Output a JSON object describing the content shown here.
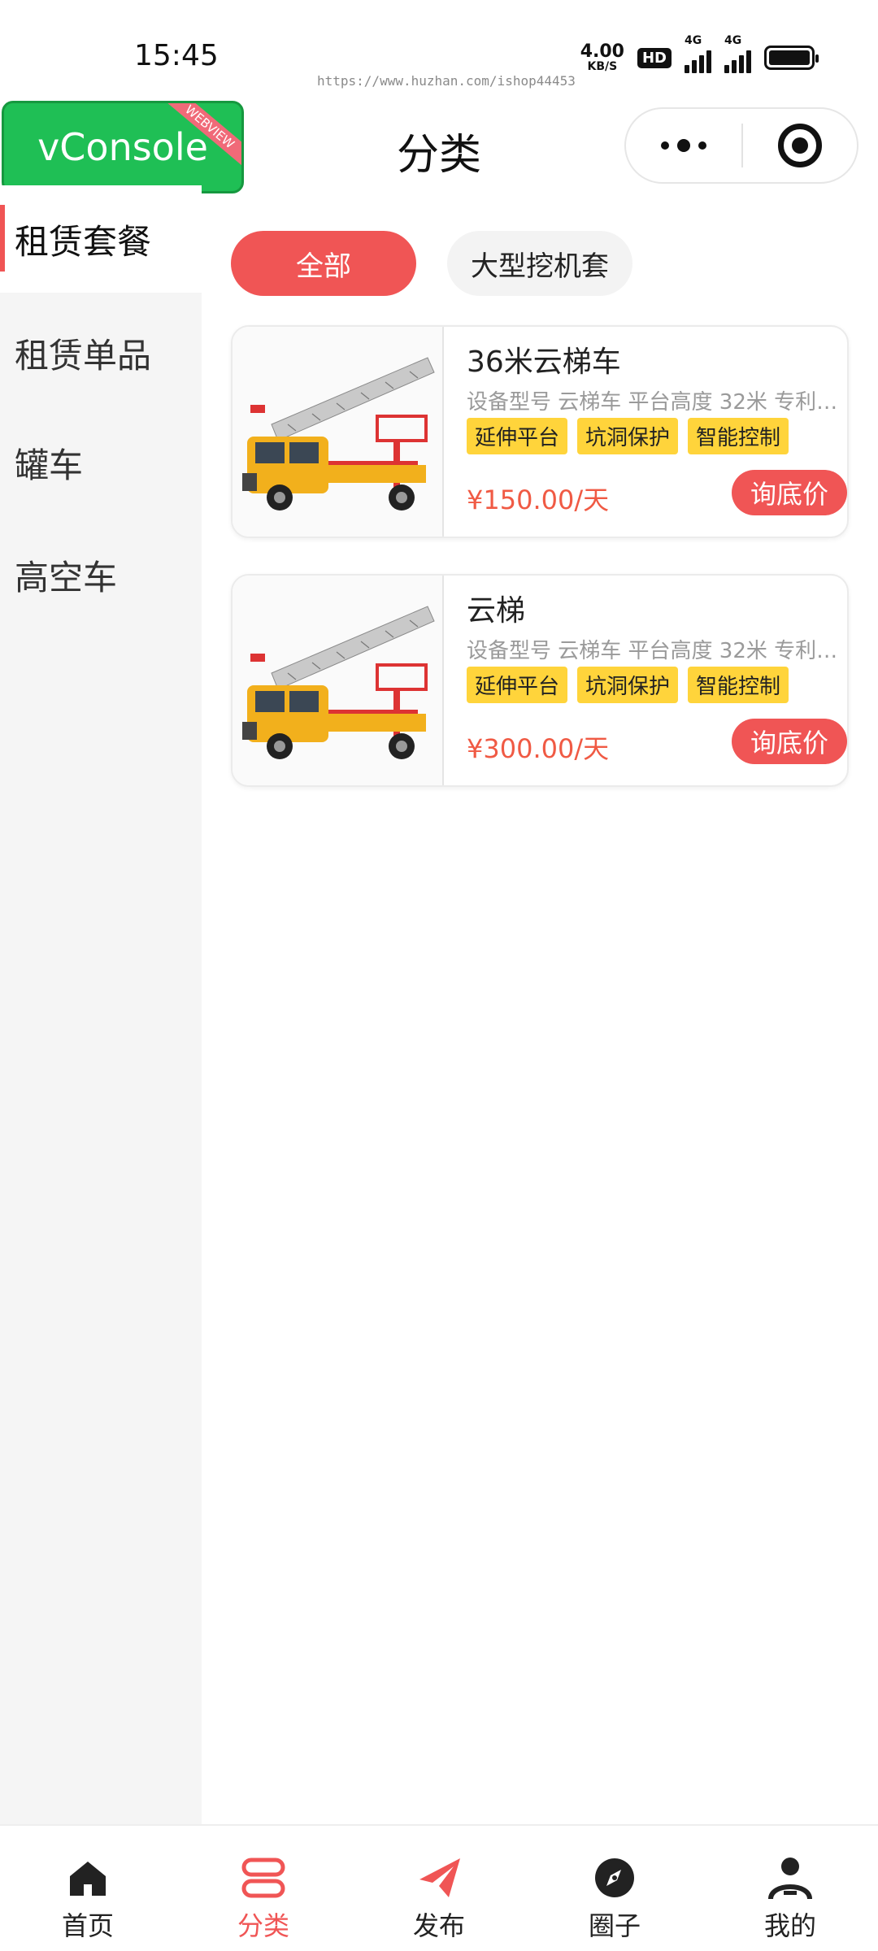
{
  "status_bar": {
    "time": "15:45",
    "watermark": "https://www.huzhan.com/ishop44453",
    "net_speed_value": "4.00",
    "net_speed_unit": "KB/S",
    "hd_label": "HD",
    "sim1_label": "4G",
    "sim2_label": "4G"
  },
  "nav": {
    "vconsole_label": "vConsole",
    "vconsole_ribbon": "WEBVIEW",
    "title": "分类"
  },
  "sidebar": {
    "items": [
      {
        "label": "租赁套餐"
      },
      {
        "label": "租赁单品"
      },
      {
        "label": "罐车"
      },
      {
        "label": "高空车"
      }
    ]
  },
  "filters": {
    "chips": [
      {
        "label": "全部"
      },
      {
        "label": "大型挖机套"
      }
    ]
  },
  "products": [
    {
      "name": "36米云梯车",
      "desc": "设备型号 云梯车 平台高度 32米 专利…",
      "tags": [
        "延伸平台",
        "坑洞保护",
        "智能控制"
      ],
      "price": "¥150.00/天",
      "ask_label": "询底价"
    },
    {
      "name": "云梯",
      "desc": "设备型号 云梯车 平台高度 32米 专利…",
      "tags": [
        "延伸平台",
        "坑洞保护",
        "智能控制"
      ],
      "price": "¥300.00/天",
      "ask_label": "询底价"
    }
  ],
  "tabbar": {
    "items": [
      {
        "label": "首页",
        "icon": "home-icon"
      },
      {
        "label": "分类",
        "icon": "category-icon"
      },
      {
        "label": "发布",
        "icon": "send-icon"
      },
      {
        "label": "圈子",
        "icon": "compass-icon"
      },
      {
        "label": "我的",
        "icon": "user-icon"
      }
    ],
    "active_color": "#f05555"
  },
  "colors": {
    "accent": "#f05555",
    "tag": "#ffd43b",
    "price": "#f05a44",
    "vconsole": "#1fbf55"
  }
}
